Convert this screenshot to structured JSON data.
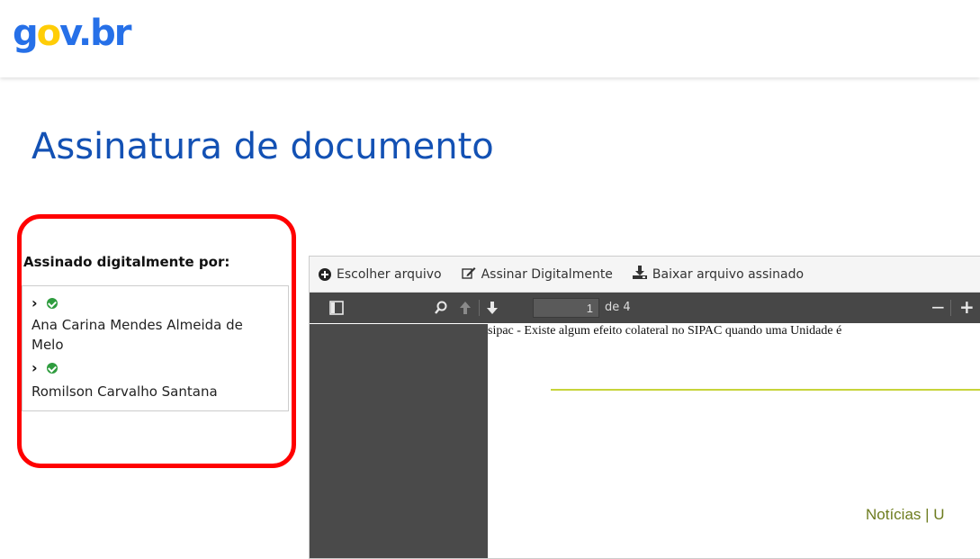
{
  "header": {
    "logo_text": "gov.br"
  },
  "page": {
    "title": "Assinatura de documento"
  },
  "signers": {
    "title": "Assinado digitalmente por:",
    "items": [
      {
        "name": "Ana Carina Mendes Almeida de Melo"
      },
      {
        "name": "Romilson Carvalho Santana"
      }
    ]
  },
  "toolbar": {
    "choose_file_label": "Escolher arquivo",
    "sign_label": "Assinar Digitalmente",
    "download_label": "Baixar arquivo assinado"
  },
  "pdf_viewer": {
    "page_number": "1",
    "page_total": "de 4",
    "zoom_out": "−",
    "zoom_in": "+"
  },
  "document": {
    "header_text": "sipac - Existe algum efeito colateral no SIPAC quando uma Unidade é",
    "nav_text": "Notícias  |  U"
  },
  "colors": {
    "title": "#1351b4",
    "highlight": "#ff0000",
    "check": "#2e9c3e"
  }
}
